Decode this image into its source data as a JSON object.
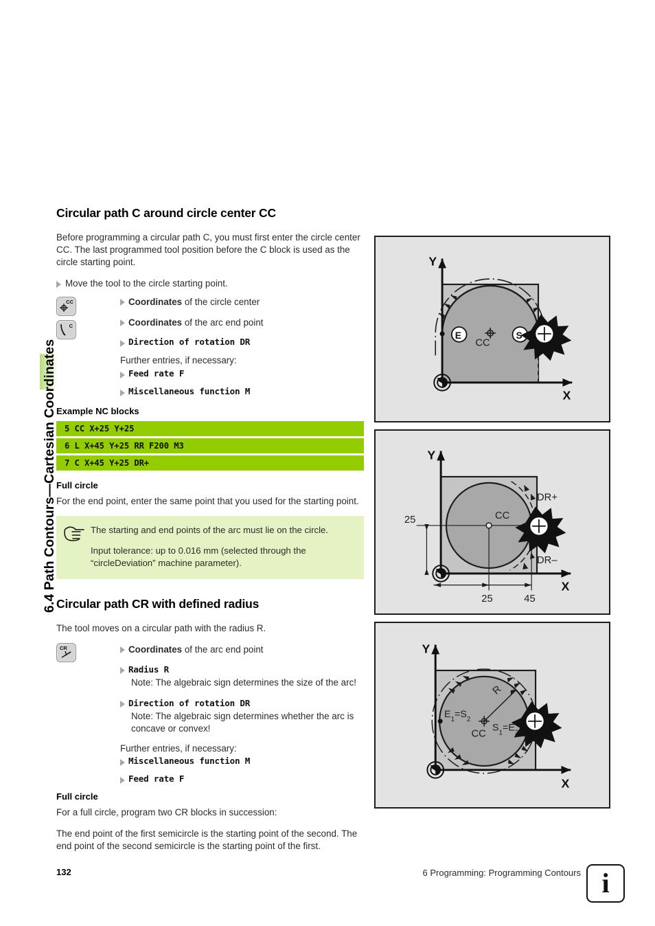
{
  "running_head": "6.4 Path Contours—Cartesian Coordinates",
  "sections": [
    {
      "heading": "Circular path C around circle center CC",
      "intro": "Before programming a circular path C, you must first enter the circle center CC. The last programmed tool position before the C block is used as the circle starting point.",
      "lead_bullet": "Move the tool to the circle starting point.",
      "keys": [
        {
          "name": "key-cc",
          "label": "CC",
          "glyph": "crosshair"
        },
        {
          "name": "key-c",
          "label": "C",
          "glyph": "arc"
        }
      ],
      "entries": [
        {
          "bold": "Coordinates",
          "rest": " of the circle center",
          "mono": false
        },
        {
          "bold": "Coordinates",
          "rest": " of the arc end point",
          "mono": false
        },
        {
          "bold": "Direction of rotation DR",
          "rest": "",
          "mono": true
        }
      ],
      "further_label": "Further entries, if necessary:",
      "further": [
        {
          "bold": "Feed rate F",
          "rest": "",
          "mono": true
        },
        {
          "bold": "Miscellaneous function M",
          "rest": "",
          "mono": true
        }
      ],
      "nc_heading": "Example NC blocks",
      "nc_blocks": [
        "5 CC X+25 Y+25",
        "6 L X+45 Y+25 RR F200 M3",
        "7 C X+45 Y+25 DR+"
      ],
      "full_circle_heading": "Full circle",
      "full_circle_text": "For the end point, enter the same point that you used for the starting point.",
      "note": [
        "The starting and end points of the arc must lie on the circle.",
        "Input tolerance: up to 0.016 mm (selected through the “circleDeviation” machine parameter)."
      ]
    },
    {
      "heading": "Circular path CR with defined radius",
      "intro": "The tool moves on a circular path with the radius R.",
      "keys": [
        {
          "name": "key-cr",
          "label": "CR",
          "glyph": "radius"
        }
      ],
      "entries": [
        {
          "bold": "Coordinates",
          "rest": " of the arc end point",
          "mono": false
        },
        {
          "bold": "Radius R",
          "rest": "",
          "mono": true,
          "note": "Note: The algebraic sign determines the size of the arc!"
        },
        {
          "bold": "Direction of rotation DR",
          "rest": "",
          "mono": true,
          "note": "Note: The algebraic sign determines whether the arc is concave or convex!"
        }
      ],
      "further_label": "Further entries, if necessary:",
      "further": [
        {
          "bold": "Miscellaneous function M",
          "rest": "",
          "mono": true
        },
        {
          "bold": "Feed rate F",
          "rest": "",
          "mono": true
        }
      ],
      "full_circle_heading": "Full circle",
      "full_circle_text": "For a full circle, program two CR blocks in succession:",
      "full_circle_text2": "The end point of the first semicircle is the starting point of the second. The end point of the second semicircle is the starting point of the first."
    }
  ],
  "figures": [
    {
      "name": "figure-arc-around-cc",
      "axis_x": "X",
      "axis_y": "Y",
      "labels": {
        "center": "CC",
        "start": "S",
        "end": "E"
      }
    },
    {
      "name": "figure-full-circle-dimensions",
      "axis_x": "X",
      "axis_y": "Y",
      "labels": {
        "center": "CC",
        "dr_plus": "DR+",
        "dr_minus": "DR–"
      },
      "dimensions": {
        "y": "25",
        "x1": "25",
        "x2": "45"
      }
    },
    {
      "name": "figure-two-cr-semicircles",
      "axis_x": "X",
      "axis_y": "Y",
      "labels": {
        "center": "CC",
        "radius": "R",
        "left_point": "E₁=S₂",
        "right_point": "S₁=E₂"
      }
    }
  ],
  "footer": {
    "page_number": "132",
    "chapter": "6 Programming: Programming Contours",
    "info_glyph": "i"
  },
  "colors": {
    "nc_block_green": "#93cc00",
    "note_green": "#e4f2c4",
    "tab_green": "#b9dd7e",
    "figure_bg": "#e3e3e3",
    "figure_fill": "#a8a8a8",
    "figure_fill_light": "#c4c4c4"
  }
}
